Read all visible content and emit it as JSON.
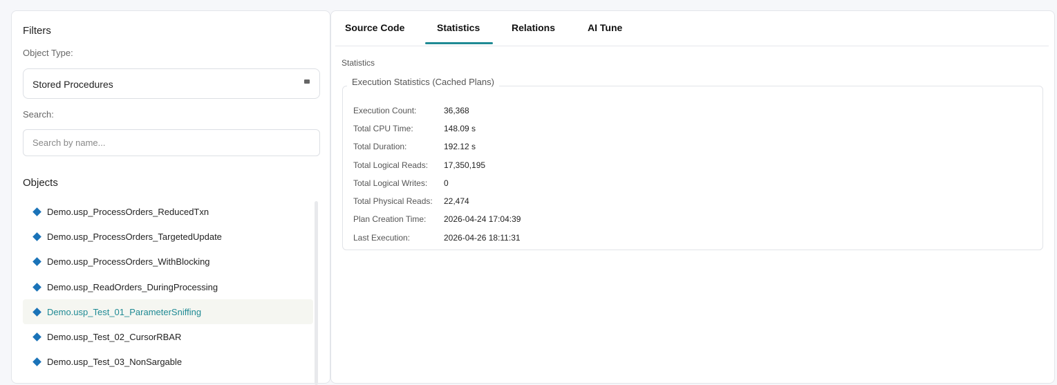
{
  "filters": {
    "title": "Filters",
    "object_type_label": "Object Type:",
    "object_type_value": "Stored Procedures",
    "search_label": "Search:",
    "search_placeholder": "Search by name...",
    "search_value": ""
  },
  "objects": {
    "title": "Objects",
    "items": [
      "Demo.usp_ProcessOrders_ReducedTxn",
      "Demo.usp_ProcessOrders_TargetedUpdate",
      "Demo.usp_ProcessOrders_WithBlocking",
      "Demo.usp_ReadOrders_DuringProcessing",
      "Demo.usp_Test_01_ParameterSniffing",
      "Demo.usp_Test_02_CursorRBAR",
      "Demo.usp_Test_03_NonSargable"
    ],
    "selected_index": 4
  },
  "tabs": [
    "Source Code",
    "Statistics",
    "Relations",
    "AI Tune"
  ],
  "active_tab": "Statistics",
  "statistics": {
    "section_label": "Statistics",
    "group_title": "Execution Statistics (Cached Plans)",
    "rows": [
      {
        "key": "Execution Count:",
        "value": "36,368"
      },
      {
        "key": "Total CPU Time:",
        "value": "148.09 s"
      },
      {
        "key": "Total Duration:",
        "value": "192.12 s"
      },
      {
        "key": "Total Logical Reads:",
        "value": "17,350,195"
      },
      {
        "key": "Total Logical Writes:",
        "value": "0"
      },
      {
        "key": "Total Physical Reads:",
        "value": "22,474"
      },
      {
        "key": "Plan Creation Time:",
        "value": "2026-04-24 17:04:39"
      },
      {
        "key": "Last Execution:",
        "value": "2026-04-26 18:11:31"
      }
    ]
  },
  "colors": {
    "accent": "#1f8a94",
    "diamond": "#1a73b8"
  }
}
